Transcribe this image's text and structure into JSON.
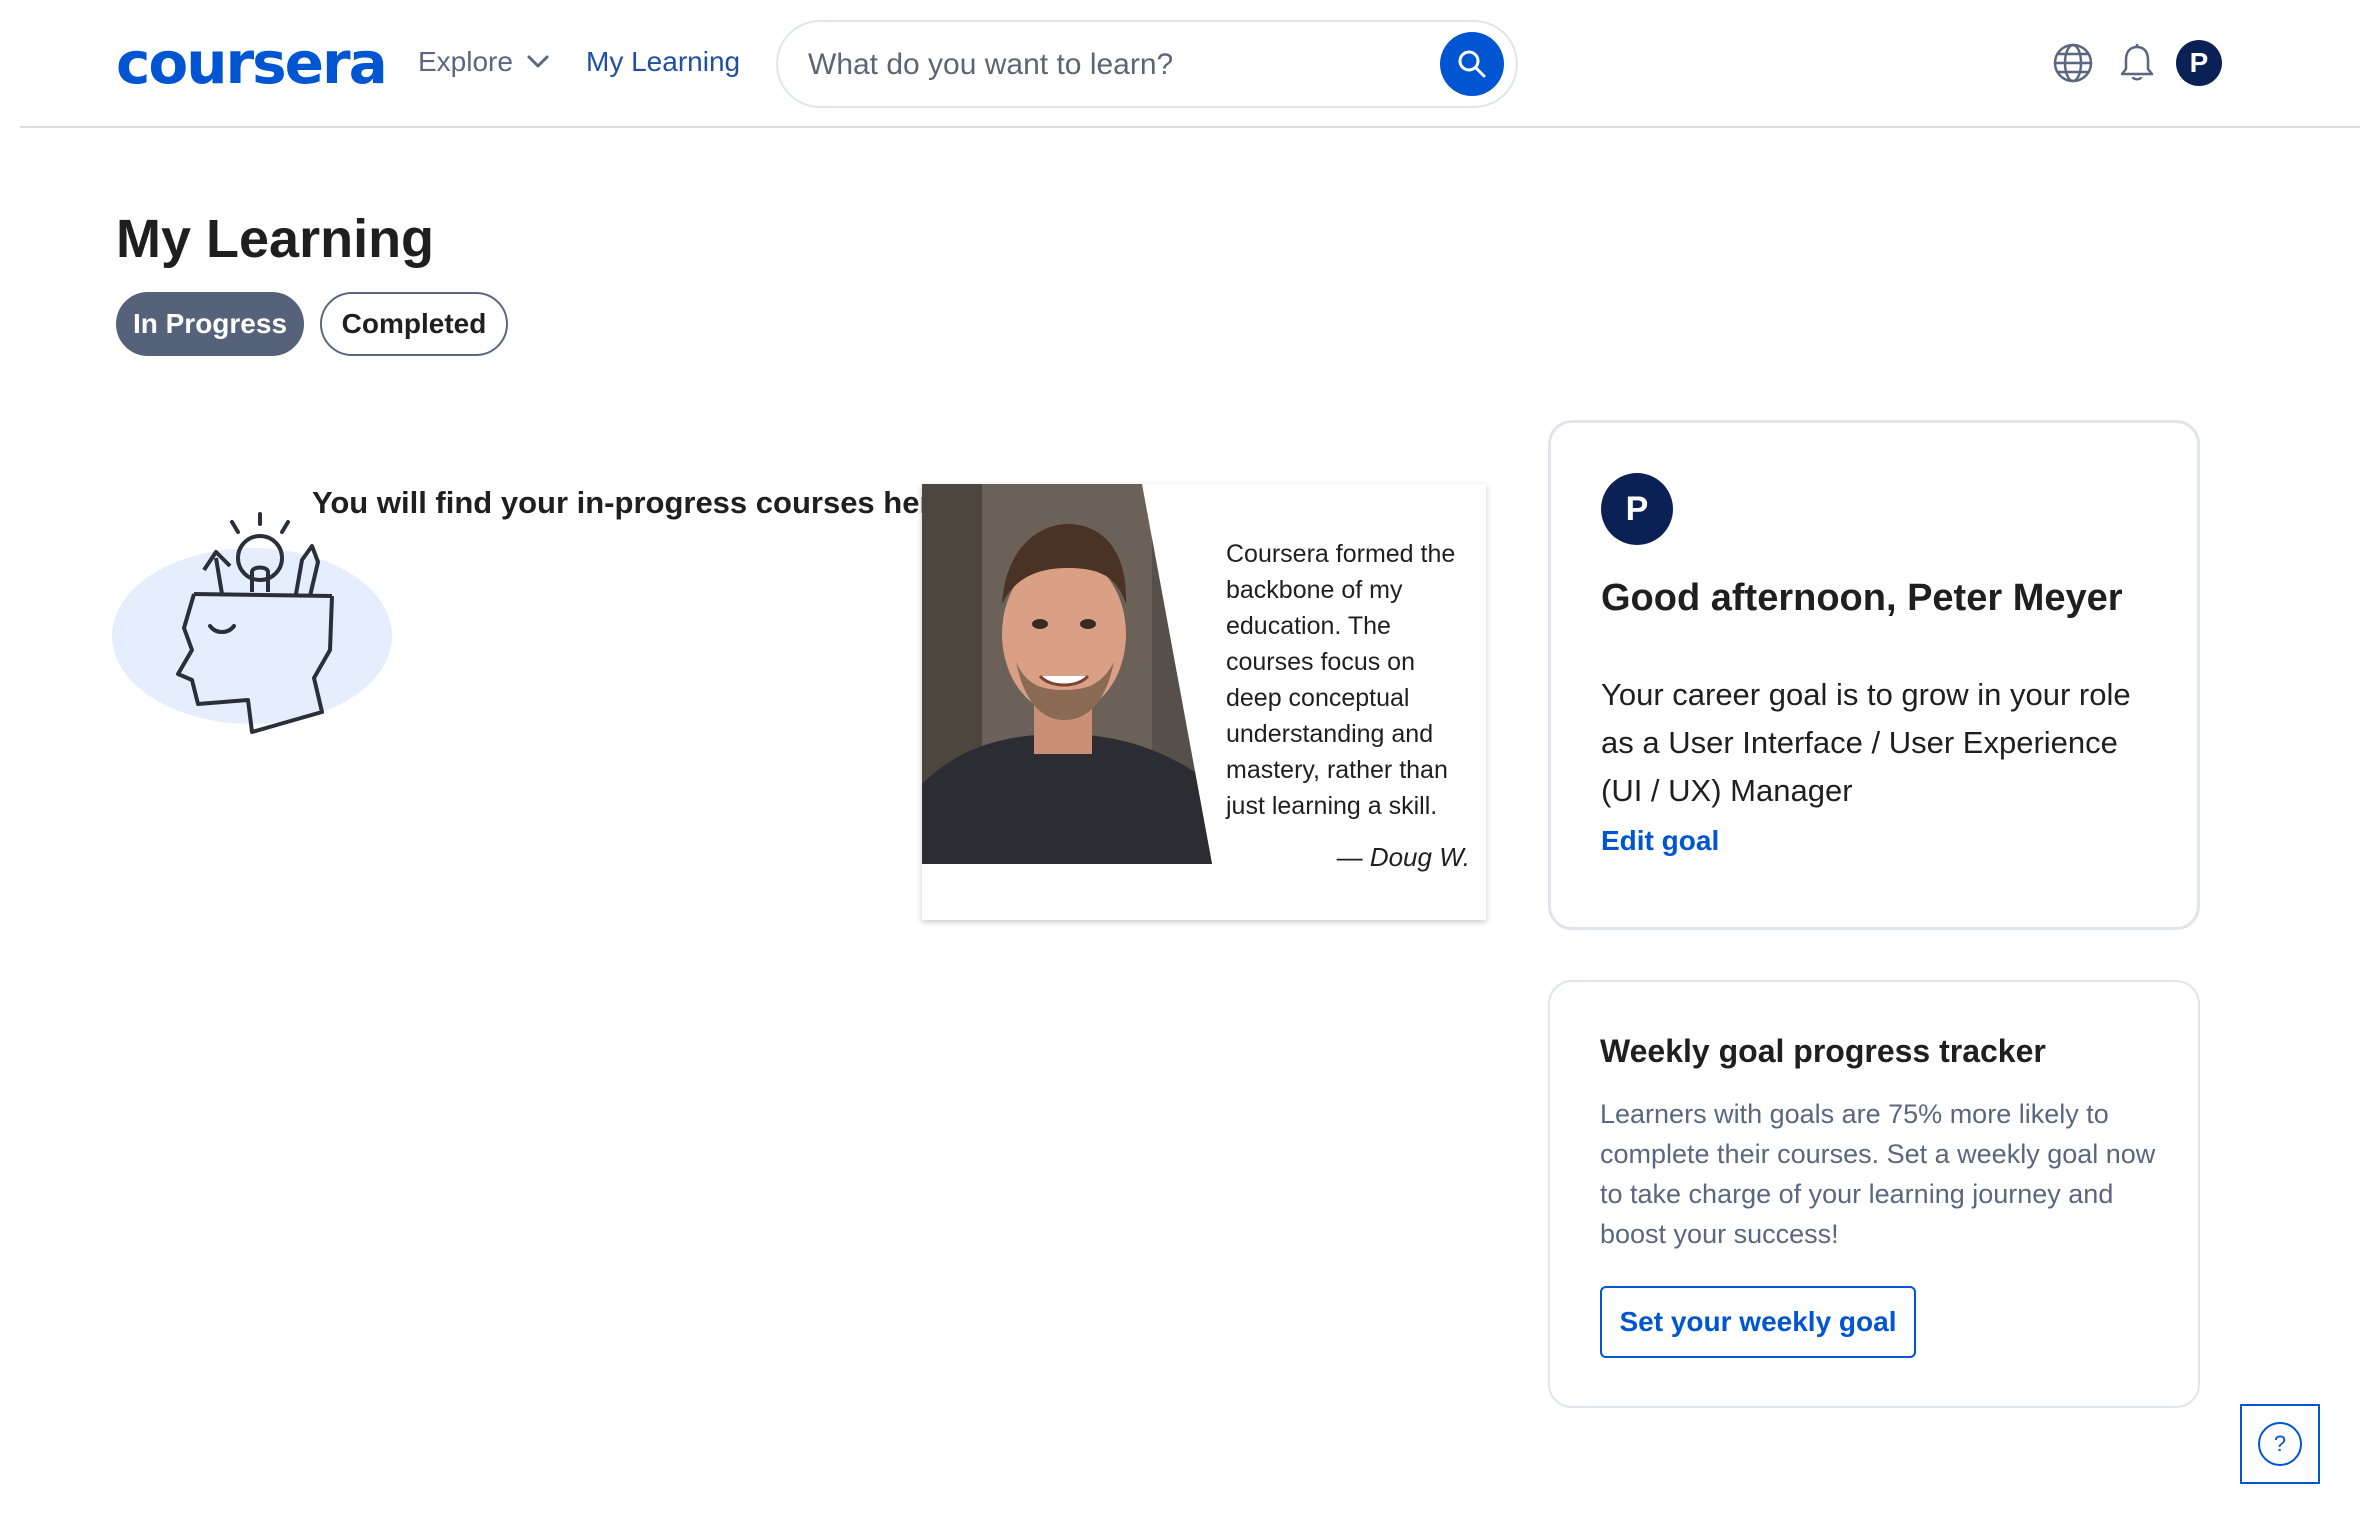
{
  "header": {
    "logo": "coursera",
    "explore_label": "Explore",
    "my_learning_label": "My Learning",
    "search_placeholder": "What do you want to learn?",
    "avatar_initial": "P"
  },
  "main": {
    "title": "My Learning",
    "tabs": [
      {
        "label": "In Progress",
        "active": true
      },
      {
        "label": "Completed",
        "active": false
      }
    ],
    "empty_message": "You will find your in-progress courses here."
  },
  "testimonial": {
    "quote": "Coursera formed the backbone of my education. The courses focus on deep conceptual understanding and mastery, rather than just learning a skill.",
    "author": "— Doug W."
  },
  "goal_card": {
    "avatar_initial": "P",
    "greeting": "Good afternoon, Peter Meyer",
    "career_text": "Your career goal is to grow in your role as a User Interface / User Experience (UI / UX) Manager",
    "edit_label": "Edit goal"
  },
  "weekly_card": {
    "title": "Weekly goal progress tracker",
    "description": "Learners with goals are 75% more likely to complete their courses. Set a weekly goal now to take charge of your learning journey and boost your success!",
    "button_label": "Set your weekly goal"
  },
  "help": {
    "label": "?"
  },
  "colors": {
    "brand": "#0056d2",
    "dark_navy": "#0b2155",
    "active_tab": "#56627a"
  },
  "icons": [
    "search-icon",
    "chevron-down-icon",
    "globe-icon",
    "bell-icon",
    "help-icon"
  ]
}
